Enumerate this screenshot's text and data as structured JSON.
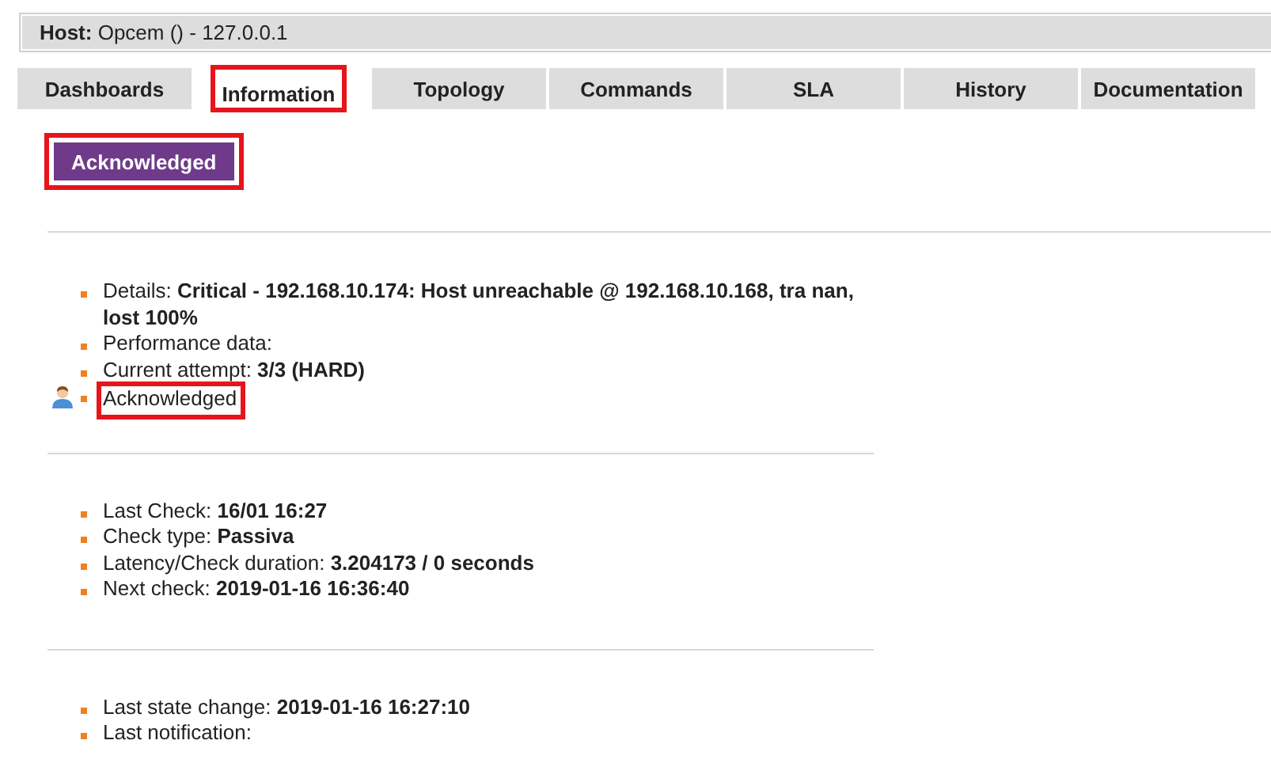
{
  "host_bar": {
    "label": "Host:",
    "value": "Opcem () - 127.0.0.1"
  },
  "tabs": [
    {
      "label": "Dashboards",
      "selected": false,
      "highlighted": false
    },
    {
      "label": "Information",
      "selected": true,
      "highlighted": true
    },
    {
      "label": "Topology",
      "selected": false,
      "highlighted": false
    },
    {
      "label": "Commands",
      "selected": false,
      "highlighted": false
    },
    {
      "label": "SLA",
      "selected": false,
      "highlighted": false
    },
    {
      "label": "History",
      "selected": false,
      "highlighted": false
    },
    {
      "label": "Documentation",
      "selected": false,
      "highlighted": false
    }
  ],
  "status_button": {
    "label": "Acknowledged",
    "highlighted": true
  },
  "sections": [
    {
      "items": [
        {
          "kind": "detail",
          "text": "Details: **Critical - 192.168.10.174: Host unreachable @ 192.168.10.168, tra nan, lost 100%**",
          "highlighted": false
        },
        {
          "kind": "detail",
          "text": "Performance data:",
          "highlighted": false
        },
        {
          "kind": "detail",
          "text": "Current attempt: **3/3 (HARD)**",
          "highlighted": false
        },
        {
          "kind": "acknowledged",
          "text": "Acknowledged",
          "highlighted": true
        }
      ]
    },
    {
      "items": [
        {
          "kind": "detail",
          "text": "Last Check: **16/01 16:27**",
          "highlighted": false
        },
        {
          "kind": "detail",
          "text": "Check type: **Passiva**",
          "highlighted": false
        },
        {
          "kind": "detail",
          "text": "Latency/Check duration: **3.204173 / 0 seconds**",
          "highlighted": false
        },
        {
          "kind": "detail",
          "text": "Next check: **2019-01-16 16:36:40**",
          "highlighted": false
        }
      ]
    },
    {
      "items": [
        {
          "kind": "detail",
          "text": "Last state change: **2019-01-16 16:27:10**",
          "highlighted": false
        },
        {
          "kind": "detail",
          "text": "Last notification:",
          "highlighted": false
        }
      ]
    }
  ]
}
